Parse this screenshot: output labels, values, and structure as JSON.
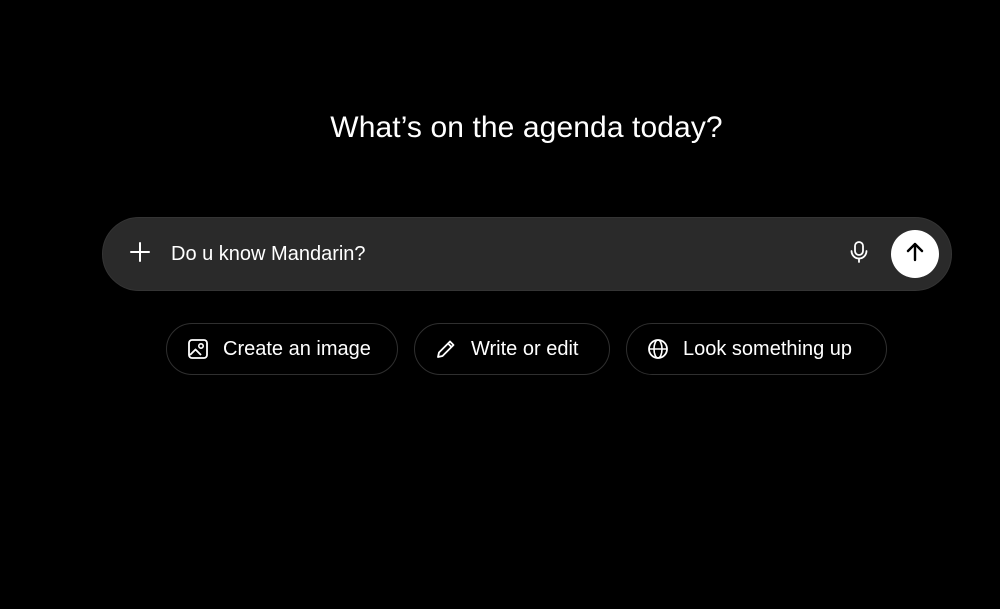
{
  "heading": "What’s on the agenda today?",
  "composer": {
    "input_value": "Do u know Mandarin?",
    "add_icon": "plus-icon",
    "mic_icon": "microphone-icon",
    "send_icon": "arrow-up-icon"
  },
  "chips": [
    {
      "label": "Create an image",
      "icon": "image-icon"
    },
    {
      "label": "Write or edit",
      "icon": "pencil-icon"
    },
    {
      "label": "Look something up",
      "icon": "globe-icon"
    }
  ],
  "colors": {
    "background": "#000000",
    "composer_bg": "#2a2a2a",
    "text": "#ffffff",
    "send_button_bg": "#ffffff"
  }
}
